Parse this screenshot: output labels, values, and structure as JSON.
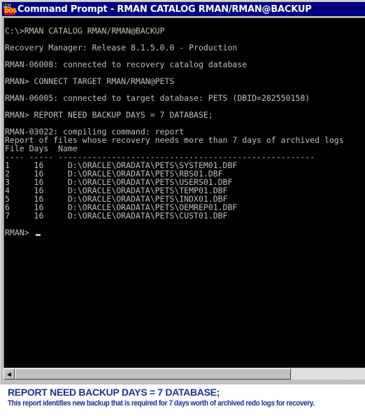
{
  "window": {
    "title": "Command Prompt - RMAN CATALOG RMAN/RMAN@BACKUP",
    "icon": "ms-dos-icon"
  },
  "console": {
    "lines": [
      "C:\\>RMAN CATALOG RMAN/RMAN@BACKUP",
      "",
      "Recovery Manager: Release 8.1.5.0.0 - Production",
      "",
      "RMAN-06008: connected to recovery catalog database",
      "",
      "RMAN> CONNECT TARGET RMAN/RMAN@PETS",
      "",
      "RMAN-06005: connected to target database: PETS (DBID=282550158)",
      "",
      "RMAN> REPORT NEED BACKUP DAYS = 7 DATABASE;",
      "",
      "RMAN-03022: compiling command: report",
      "Report of files whose recovery needs more than 7 days of archived logs",
      "File Days  Name",
      "---- ----- -----------------------------------------------------"
    ],
    "report_rows": [
      {
        "file": "1",
        "days": "16",
        "name": "D:\\ORACLE\\ORADATA\\PETS\\SYSTEM01.DBF"
      },
      {
        "file": "2",
        "days": "16",
        "name": "D:\\ORACLE\\ORADATA\\PETS\\RBS01.DBF"
      },
      {
        "file": "3",
        "days": "16",
        "name": "D:\\ORACLE\\ORADATA\\PETS\\USERS01.DBF"
      },
      {
        "file": "4",
        "days": "16",
        "name": "D:\\ORACLE\\ORADATA\\PETS\\TEMP01.DBF"
      },
      {
        "file": "5",
        "days": "16",
        "name": "D:\\ORACLE\\ORADATA\\PETS\\INDX01.DBF"
      },
      {
        "file": "6",
        "days": "16",
        "name": "D:\\ORACLE\\ORADATA\\PETS\\OEMREP01.DBF"
      },
      {
        "file": "7",
        "days": "16",
        "name": "D:\\ORACLE\\ORADATA\\PETS\\CUST01.DBF"
      }
    ],
    "prompt": "RMAN> "
  },
  "scrollbar": {
    "left_arrow": "scroll-left-arrow"
  },
  "caption": {
    "title": "REPORT NEED BACKUP DAYS = 7 DATABASE;",
    "description": "This report identifies new backup that is required for 7 days worth of archived redo logs for recovery.",
    "color": "#1f2f8f"
  }
}
